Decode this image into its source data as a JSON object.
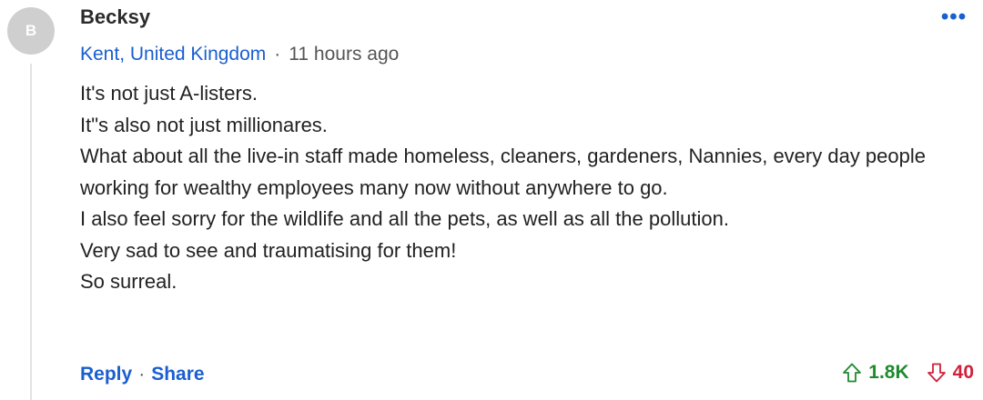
{
  "comment": {
    "avatar_initial": "B",
    "author": "Becksy",
    "location": "Kent, United Kingdom",
    "separator": "·",
    "time": "11 hours ago",
    "lines": [
      "It's not just A-listers.",
      "It\"s also not just millionares.",
      "What about all the live-in staff made homeless, cleaners, gardeners, Nannies, every day people working for wealthy employees many now without anywhere to go.",
      "I also feel sorry for the wildlife and all the pets, as well as all the pollution.",
      "Very sad to see and traumatising for them!",
      "So surreal."
    ],
    "actions": {
      "reply": "Reply",
      "dot": "·",
      "share": "Share"
    },
    "votes": {
      "up_count": "1.8K",
      "down_count": "40"
    }
  },
  "icons": {
    "more": "more-options-icon",
    "up": "up-arrow-icon",
    "down": "down-arrow-icon"
  },
  "colors": {
    "link": "#1a5fd0",
    "upvote": "#1f8a2e",
    "downvote": "#d0203a",
    "avatar_bg": "#cfcfcf"
  }
}
